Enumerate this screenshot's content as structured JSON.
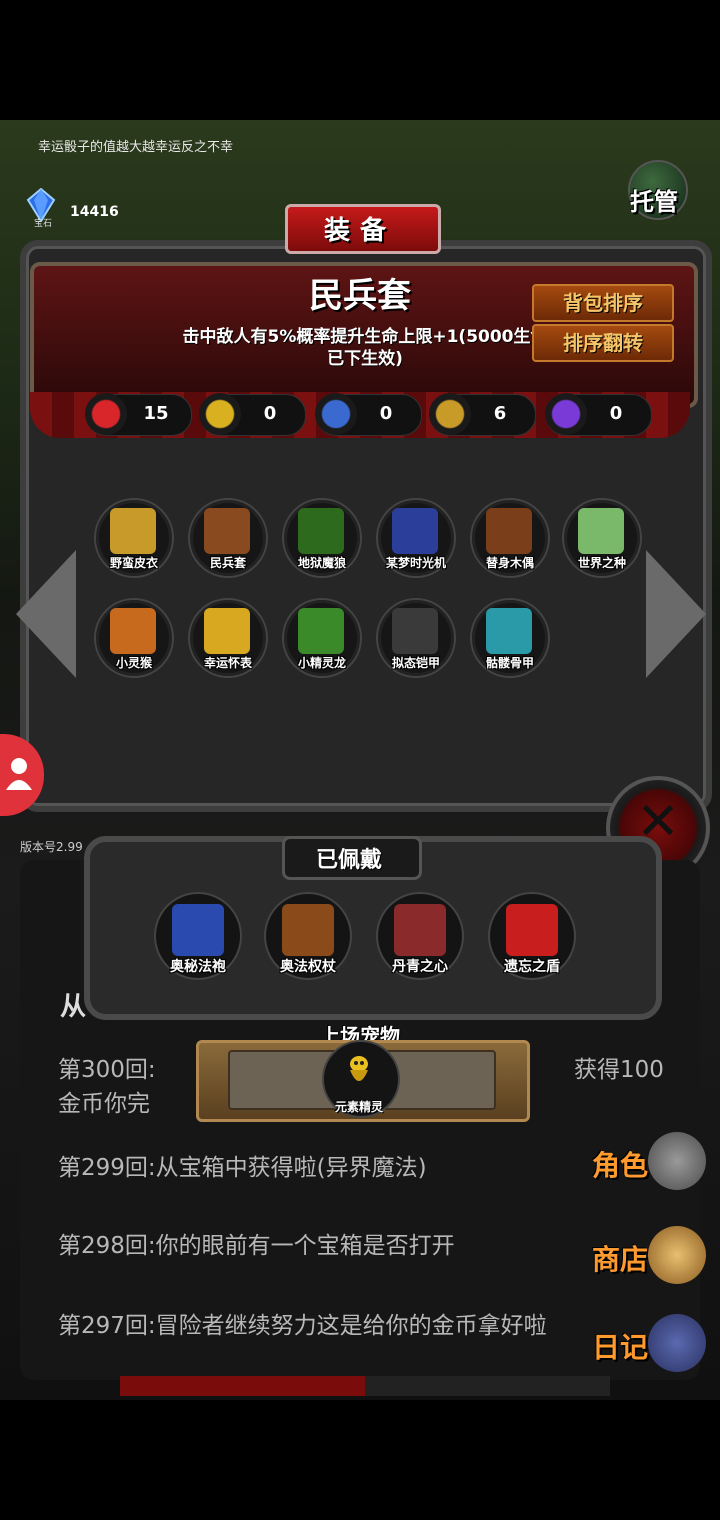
{
  "header": {
    "tip": "幸运骰子的值越大越幸运反之不幸",
    "gems": "14416",
    "gems_label": "宝石",
    "auto_button": "托管"
  },
  "panel": {
    "title": "装备",
    "set_name": "民兵套",
    "set_desc": "击中敌人有5%概率提升生命上限+1(5000生命已下生效)",
    "sort_button": "背包排序",
    "flip_button": "排序翻转",
    "stats": [
      {
        "icon": "heart-icon",
        "value": "15",
        "color": "#d8262a"
      },
      {
        "icon": "strength-icon",
        "value": "0",
        "color": "#d9b020"
      },
      {
        "icon": "armor-icon",
        "value": "0",
        "color": "#3a6ad0"
      },
      {
        "icon": "weapon-icon",
        "value": "6",
        "color": "#c89a28"
      },
      {
        "icon": "lightning-icon",
        "value": "0",
        "color": "#7a3ad8"
      }
    ],
    "items": [
      {
        "label": "野蛮皮衣",
        "color": "#c89a2a"
      },
      {
        "label": "民兵套",
        "color": "#8a4a20"
      },
      {
        "label": "地狱魔狼",
        "color": "#2e6a1e"
      },
      {
        "label": "某梦时光机",
        "color": "#2a3e9a"
      },
      {
        "label": "替身木偶",
        "color": "#7a3e1a"
      },
      {
        "label": "世界之种",
        "color": "#7ab86a"
      },
      {
        "label": "小灵猴",
        "color": "#c86a1e"
      },
      {
        "label": "幸运怀表",
        "color": "#d8a820"
      },
      {
        "label": "小精灵龙",
        "color": "#3a8a2a"
      },
      {
        "label": "拟态铠甲",
        "color": "#3a3a3a"
      },
      {
        "label": "骷髅骨甲",
        "color": "#2a9aa8"
      }
    ]
  },
  "worn": {
    "title": "已佩戴",
    "items": [
      {
        "label": "奥秘法袍",
        "color": "#2a4ab0"
      },
      {
        "label": "奥法权杖",
        "color": "#8a4a1a"
      },
      {
        "label": "丹青之心",
        "color": "#8a2a2a"
      },
      {
        "label": "遗忘之盾",
        "color": "#c81e1e"
      }
    ]
  },
  "pet": {
    "title": "上场宠物",
    "name": "元素精灵"
  },
  "log": {
    "head": "从",
    "lines": [
      "第300回:",
      "金币你完",
      "第299回:从宝箱中获得啦(异界魔法)",
      "第298回:你的眼前有一个宝箱是否打开",
      "第297回:冒险者继续努力这是给你的金币拿好啦"
    ],
    "tail": "获得100"
  },
  "menu": {
    "role": "角色",
    "shop": "商店",
    "diary": "日记"
  },
  "version": "版本号2.99"
}
